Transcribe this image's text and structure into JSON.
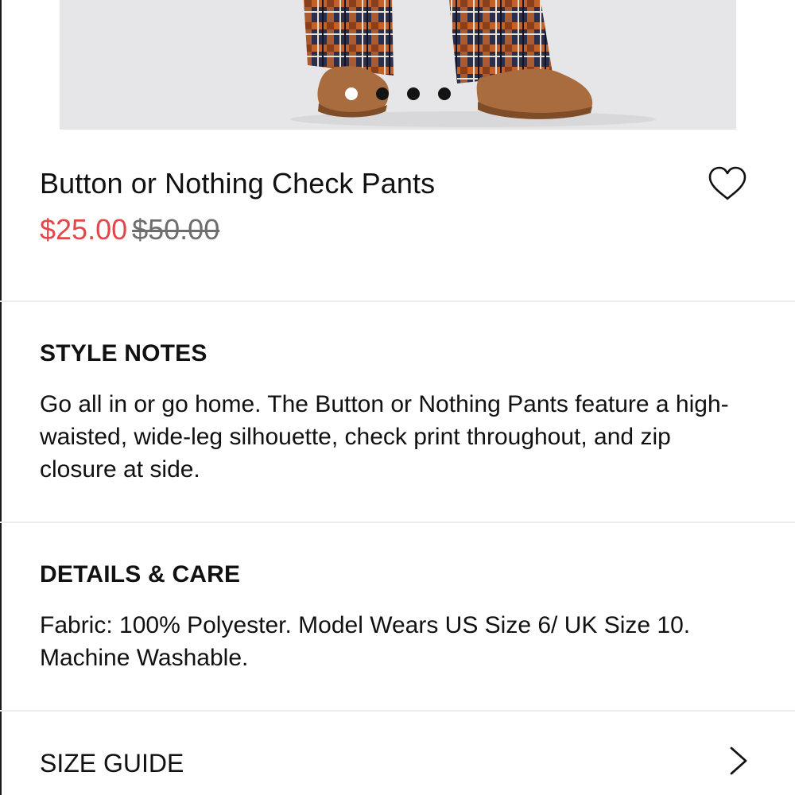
{
  "carousel": {
    "slide_count": 4,
    "active_index": 0
  },
  "product": {
    "title": "Button or Nothing Check Pants",
    "sale_price": "$25.00",
    "original_price": "$50.00",
    "sale_color": "#e2484a"
  },
  "icons": {
    "wishlist": "heart-outline-icon",
    "size_guide": "chevron-right-icon"
  },
  "style_notes": {
    "heading": "STYLE NOTES",
    "body": "Go all in or go home. The Button or Nothing Pants feature a high-waisted, wide-leg silhouette, check print throughout, and zip closure at side."
  },
  "details_care": {
    "heading": "DETAILS & CARE",
    "body": "Fabric: 100% Polyester. Model Wears US Size 6/ UK Size 10. Machine Washable."
  },
  "size_guide": {
    "label": "SIZE GUIDE"
  }
}
